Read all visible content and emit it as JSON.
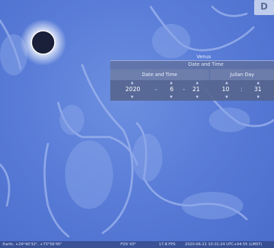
{
  "planet_label": "Venus",
  "dialog": {
    "title": "Date and Time",
    "tab_active": "Date and Time",
    "tab_other": "Julian Day",
    "year": "2020",
    "month": "6",
    "day": "21",
    "hour": "10",
    "minute": "31",
    "sep_date": "-",
    "sep_time": ":"
  },
  "corner_button": "D",
  "status": {
    "location": "Earth, +29°40'32\", +73°56'45\"",
    "fov": "FOV 43°",
    "fps": "17.8 FPS",
    "datetime": "2020-06-21 10:31:24 UTC+04:55 (LMST)"
  },
  "colors": {
    "sky": "#5a7dd8",
    "sun_core": "#1a1f3a",
    "sun_glow": "#ffffff"
  }
}
